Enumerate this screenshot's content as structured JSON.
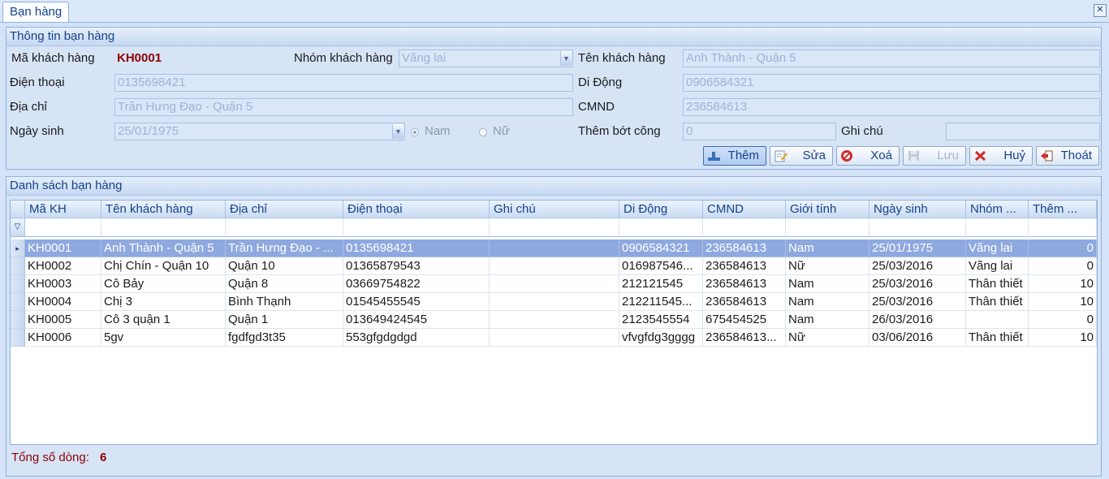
{
  "tab": {
    "label": "Bạn hàng"
  },
  "info": {
    "title": "Thông tin bạn hàng",
    "ma_kh_label": "Mã khách hàng",
    "ma_kh_value": "KH0001",
    "nhom_label": "Nhóm khách hàng",
    "nhom_value": "Vãng lai",
    "ten_label": "Tên khách hàng",
    "ten_value": "Anh Thành - Quận 5",
    "dienthoai_label": "Điện thoại",
    "dienthoai_value": "0135698421",
    "didong_label": "Di Động",
    "didong_value": "0906584321",
    "diachi_label": "Địa chỉ",
    "diachi_value": "Trần Hưng Đạo - Quận 5",
    "cmnd_label": "CMND",
    "cmnd_value": "236584613",
    "ngaysinh_label": "Ngày sinh",
    "ngaysinh_value": "25/01/1975",
    "gender_male": "Nam",
    "gender_female": "Nữ",
    "gender_selected": "Nam",
    "thembot_label": "Thêm bớt công",
    "thembot_value": "0",
    "ghichu_label": "Ghi chú",
    "ghichu_value": ""
  },
  "buttons": {
    "them": "Thêm",
    "sua": "Sửa",
    "xoa": "Xoá",
    "luu": "Lưu",
    "huy": "Huỷ",
    "thoat": "Thoát"
  },
  "list": {
    "title": "Danh sách bạn hàng",
    "columns": [
      "Mã KH",
      "Tên khách hàng",
      "Địa chỉ",
      "Điện thoại",
      "Ghi chú",
      "Di Động",
      "CMND",
      "Giới tính",
      "Ngày sinh",
      "Nhóm ...",
      "Thêm ..."
    ],
    "rows": [
      [
        "KH0001",
        "Anh Thành - Quận 5",
        "Trần Hưng Đạo - ...",
        "0135698421",
        "",
        "0906584321",
        "236584613",
        "Nam",
        "25/01/1975",
        "Vãng lai",
        "0"
      ],
      [
        "KH0002",
        "Chị Chín - Quận 10",
        "Quận 10",
        "01365879543",
        "",
        "016987546...",
        "236584613",
        "Nữ",
        "25/03/2016",
        "Vãng lai",
        "0"
      ],
      [
        "KH0003",
        "Cô Bảy",
        "Quận 8",
        "03669754822",
        "",
        "212121545",
        "236584613",
        "Nam",
        "25/03/2016",
        "Thân thiết",
        "10"
      ],
      [
        "KH0004",
        "Chị 3",
        "Bình Thạnh",
        "01545455545",
        "",
        "212211545...",
        "236584613",
        "Nam",
        "25/03/2016",
        "Thân thiết",
        "10"
      ],
      [
        "KH0005",
        "Cô 3 quận 1",
        "Quận 1",
        "013649424545",
        "",
        "2123545554",
        "675454525",
        "Nam",
        "26/03/2016",
        "",
        "0"
      ],
      [
        "KH0006",
        "5gv",
        "fgdfgd3t35",
        "553gfgdgdgd",
        "",
        "vfvgfdg3gggg",
        "236584613...",
        "Nữ",
        "03/06/2016",
        "Thân thiết",
        "10"
      ]
    ],
    "selected_index": 0,
    "total_label": "Tổng số dòng:",
    "total_value": "6"
  },
  "colors": {
    "accent": "#15428b",
    "code_red": "#8b0000",
    "selection": "#8ea8e0",
    "panel_bg": "#d6e4f6"
  }
}
